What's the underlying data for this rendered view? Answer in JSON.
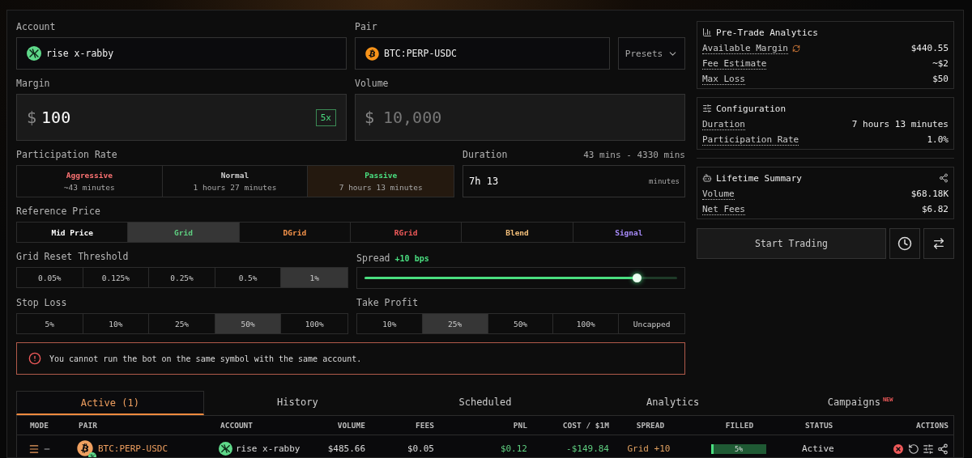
{
  "account": {
    "label": "Account",
    "value": "rise x-rabby"
  },
  "pair": {
    "label": "Pair",
    "value": "BTC:PERP-USDC"
  },
  "presets": {
    "label": "Presets"
  },
  "margin": {
    "label": "Margin",
    "currency": "$",
    "value": "100",
    "leverage": "5x"
  },
  "volume": {
    "label": "Volume",
    "currency": "$",
    "placeholder": "10,000"
  },
  "participation": {
    "label": "Participation Rate",
    "options": [
      {
        "name": "Aggressive",
        "time": "~43 minutes",
        "color": "#f87171",
        "selected": false
      },
      {
        "name": "Normal",
        "time": "1 hours 27 minutes",
        "color": "#cfcfcf",
        "selected": false
      },
      {
        "name": "Passive",
        "time": "7 hours 13 minutes",
        "color": "#4ade80",
        "selected": true
      }
    ]
  },
  "duration": {
    "label": "Duration",
    "range": "43 mins - 4330 mins",
    "value": "7h 13",
    "unit": "minutes"
  },
  "reference_price": {
    "label": "Reference Price",
    "options": [
      {
        "label": "Mid Price",
        "color": "#ffffff",
        "selected": false
      },
      {
        "label": "Grid",
        "color": "#5fcf80",
        "selected": true
      },
      {
        "label": "DGrid",
        "color": "#f5934a",
        "selected": false
      },
      {
        "label": "RGrid",
        "color": "#f05a5a",
        "selected": false
      },
      {
        "label": "Blend",
        "color": "#f5c07a",
        "selected": false
      },
      {
        "label": "Signal",
        "color": "#a78bfa",
        "selected": false
      }
    ]
  },
  "grid_reset": {
    "label": "Grid Reset Threshold",
    "options": [
      {
        "label": "0.05%",
        "selected": false
      },
      {
        "label": "0.125%",
        "selected": false
      },
      {
        "label": "0.25%",
        "selected": false
      },
      {
        "label": "0.5%",
        "selected": false
      },
      {
        "label": "1%",
        "selected": true
      }
    ]
  },
  "spread": {
    "label": "Spread",
    "value": "+10 bps",
    "level": 0.87
  },
  "stop_loss": {
    "label": "Stop Loss",
    "options": [
      {
        "label": "5%",
        "selected": false
      },
      {
        "label": "10%",
        "selected": false
      },
      {
        "label": "25%",
        "selected": false
      },
      {
        "label": "50%",
        "selected": true
      },
      {
        "label": "100%",
        "selected": false
      }
    ]
  },
  "take_profit": {
    "label": "Take Profit",
    "options": [
      {
        "label": "10%",
        "selected": false
      },
      {
        "label": "25%",
        "selected": true
      },
      {
        "label": "50%",
        "selected": false
      },
      {
        "label": "100%",
        "selected": false
      },
      {
        "label": "Uncapped",
        "selected": false
      }
    ]
  },
  "alert": {
    "message": "You cannot run the bot on the same symbol with the same account."
  },
  "pre_trade": {
    "title": "Pre-Trade Analytics",
    "rows": [
      {
        "label": "Available Margin",
        "value": "$440.55",
        "refresh": true
      },
      {
        "label": "Fee Estimate",
        "value": "~$2"
      },
      {
        "label": "Max Loss",
        "value": "$50"
      }
    ]
  },
  "configuration": {
    "title": "Configuration",
    "rows": [
      {
        "label": "Duration",
        "value": "7 hours 13 minutes"
      },
      {
        "label": "Participation Rate",
        "value": "1.0%"
      }
    ]
  },
  "lifetime": {
    "title": "Lifetime Summary",
    "rows": [
      {
        "label": "Volume",
        "value": "$68.18K"
      },
      {
        "label": "Net Fees",
        "value": "$6.82"
      }
    ]
  },
  "start_button": {
    "label": "Start Trading"
  },
  "tabs": [
    {
      "label": "Active (1)",
      "selected": true
    },
    {
      "label": "History",
      "selected": false
    },
    {
      "label": "Scheduled",
      "selected": false
    },
    {
      "label": "Analytics",
      "selected": false
    },
    {
      "label": "Campaigns",
      "badge": "NEW",
      "selected": false
    }
  ],
  "table": {
    "columns": [
      "MODE",
      "PAIR",
      "ACCOUNT",
      "VOLUME",
      "FEES",
      "PNL",
      "COST / $1M",
      "SPREAD",
      "FILLED",
      "STATUS",
      "ACTIONS"
    ],
    "rows": [
      {
        "pair": "BTC:PERP-USDC",
        "account": "rise x-rabby",
        "volume": "$485.66",
        "fees": "$0.05",
        "pnl": "$0.12",
        "cost": "-$149.84",
        "spread": "Grid +10",
        "filled": "5%",
        "level": 0.05,
        "status": "Active"
      }
    ]
  }
}
